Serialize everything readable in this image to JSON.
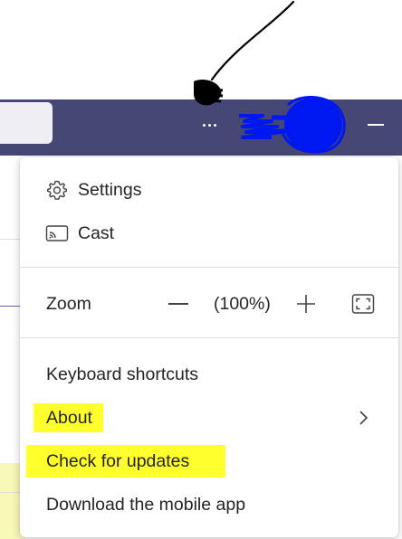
{
  "titlebar": {
    "more_options_icon": "more-horizontal-icon",
    "minimize_icon": "minimize-icon"
  },
  "colors": {
    "titlebar_bg": "#464775",
    "highlight": "#ffff2e",
    "scribble_black": "#000000",
    "scribble_blue": "#0018f0"
  },
  "menu": {
    "settings": {
      "label": "Settings",
      "icon": "gear-icon"
    },
    "cast": {
      "label": "Cast",
      "icon": "cast-icon"
    },
    "zoom": {
      "label": "Zoom",
      "value": "(100%)",
      "decrease_icon": "minus-icon",
      "increase_icon": "plus-icon",
      "fullscreen_icon": "fullscreen-icon"
    },
    "keyboard_shortcuts": {
      "label": "Keyboard shortcuts"
    },
    "about": {
      "label": "About",
      "submenu_icon": "chevron-right-icon"
    },
    "check_for_updates": {
      "label": "Check for updates"
    },
    "download_mobile_app": {
      "label": "Download the mobile app"
    }
  }
}
